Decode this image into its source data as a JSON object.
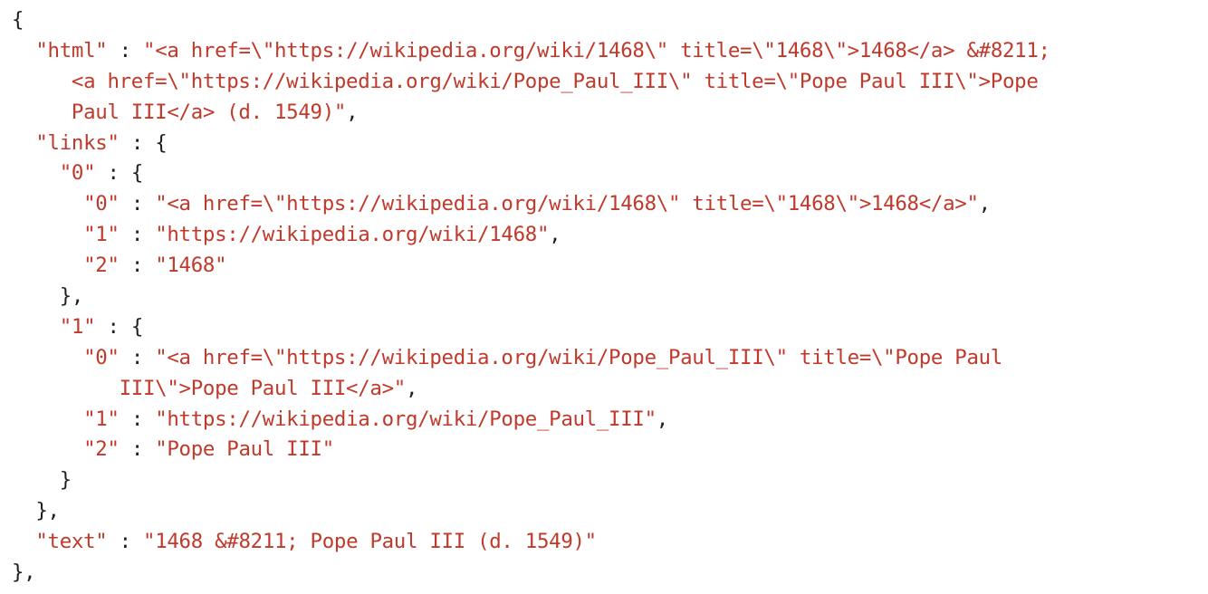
{
  "viewer": {
    "indent_unit": 2,
    "colors": {
      "key": "#c0392b",
      "string": "#c0392b",
      "punctuation": "#1f1f1f",
      "background": "#ffffff"
    }
  },
  "lines": [
    {
      "indent": 0,
      "parts": [
        {
          "t": "punct",
          "v": "{"
        }
      ]
    },
    {
      "indent": 2,
      "parts": [
        {
          "t": "key",
          "v": "\"html\""
        },
        {
          "t": "sep",
          "v": " : "
        },
        {
          "t": "str",
          "v": "\"<a href=\\\"https://wikipedia.org/wiki/1468\\\" title=\\\"1468\\\">1468</a> &#8211;"
        }
      ]
    },
    {
      "indent": 5,
      "parts": [
        {
          "t": "str",
          "v": "<a href=\\\"https://wikipedia.org/wiki/Pope_Paul_III\\\" title=\\\"Pope Paul III\\\">Pope"
        }
      ]
    },
    {
      "indent": 5,
      "parts": [
        {
          "t": "str",
          "v": "Paul III</a> (d. 1549)\""
        },
        {
          "t": "punct",
          "v": ","
        }
      ]
    },
    {
      "indent": 2,
      "parts": [
        {
          "t": "key",
          "v": "\"links\""
        },
        {
          "t": "sep",
          "v": " : "
        },
        {
          "t": "punct",
          "v": "{"
        }
      ]
    },
    {
      "indent": 4,
      "parts": [
        {
          "t": "key",
          "v": "\"0\""
        },
        {
          "t": "sep",
          "v": " : "
        },
        {
          "t": "punct",
          "v": "{"
        }
      ]
    },
    {
      "indent": 6,
      "parts": [
        {
          "t": "key",
          "v": "\"0\""
        },
        {
          "t": "sep",
          "v": " : "
        },
        {
          "t": "str",
          "v": "\"<a href=\\\"https://wikipedia.org/wiki/1468\\\" title=\\\"1468\\\">1468</a>\""
        },
        {
          "t": "punct",
          "v": ","
        }
      ]
    },
    {
      "indent": 6,
      "parts": [
        {
          "t": "key",
          "v": "\"1\""
        },
        {
          "t": "sep",
          "v": " : "
        },
        {
          "t": "str",
          "v": "\"https://wikipedia.org/wiki/1468\""
        },
        {
          "t": "punct",
          "v": ","
        }
      ]
    },
    {
      "indent": 6,
      "parts": [
        {
          "t": "key",
          "v": "\"2\""
        },
        {
          "t": "sep",
          "v": " : "
        },
        {
          "t": "str",
          "v": "\"1468\""
        }
      ]
    },
    {
      "indent": 4,
      "parts": [
        {
          "t": "punct",
          "v": "},"
        }
      ]
    },
    {
      "indent": 4,
      "parts": [
        {
          "t": "key",
          "v": "\"1\""
        },
        {
          "t": "sep",
          "v": " : "
        },
        {
          "t": "punct",
          "v": "{"
        }
      ]
    },
    {
      "indent": 6,
      "parts": [
        {
          "t": "key",
          "v": "\"0\""
        },
        {
          "t": "sep",
          "v": " : "
        },
        {
          "t": "str",
          "v": "\"<a href=\\\"https://wikipedia.org/wiki/Pope_Paul_III\\\" title=\\\"Pope Paul"
        }
      ]
    },
    {
      "indent": 9,
      "parts": [
        {
          "t": "str",
          "v": "III\\\">Pope Paul III</a>\""
        },
        {
          "t": "punct",
          "v": ","
        }
      ]
    },
    {
      "indent": 6,
      "parts": [
        {
          "t": "key",
          "v": "\"1\""
        },
        {
          "t": "sep",
          "v": " : "
        },
        {
          "t": "str",
          "v": "\"https://wikipedia.org/wiki/Pope_Paul_III\""
        },
        {
          "t": "punct",
          "v": ","
        }
      ]
    },
    {
      "indent": 6,
      "parts": [
        {
          "t": "key",
          "v": "\"2\""
        },
        {
          "t": "sep",
          "v": " : "
        },
        {
          "t": "str",
          "v": "\"Pope Paul III\""
        }
      ]
    },
    {
      "indent": 4,
      "parts": [
        {
          "t": "punct",
          "v": "}"
        }
      ]
    },
    {
      "indent": 2,
      "parts": [
        {
          "t": "punct",
          "v": "},"
        }
      ]
    },
    {
      "indent": 2,
      "parts": [
        {
          "t": "key",
          "v": "\"text\""
        },
        {
          "t": "sep",
          "v": " : "
        },
        {
          "t": "str",
          "v": "\"1468 &#8211; Pope Paul III (d. 1549)\""
        }
      ]
    },
    {
      "indent": 0,
      "parts": [
        {
          "t": "punct",
          "v": "},"
        }
      ]
    }
  ]
}
